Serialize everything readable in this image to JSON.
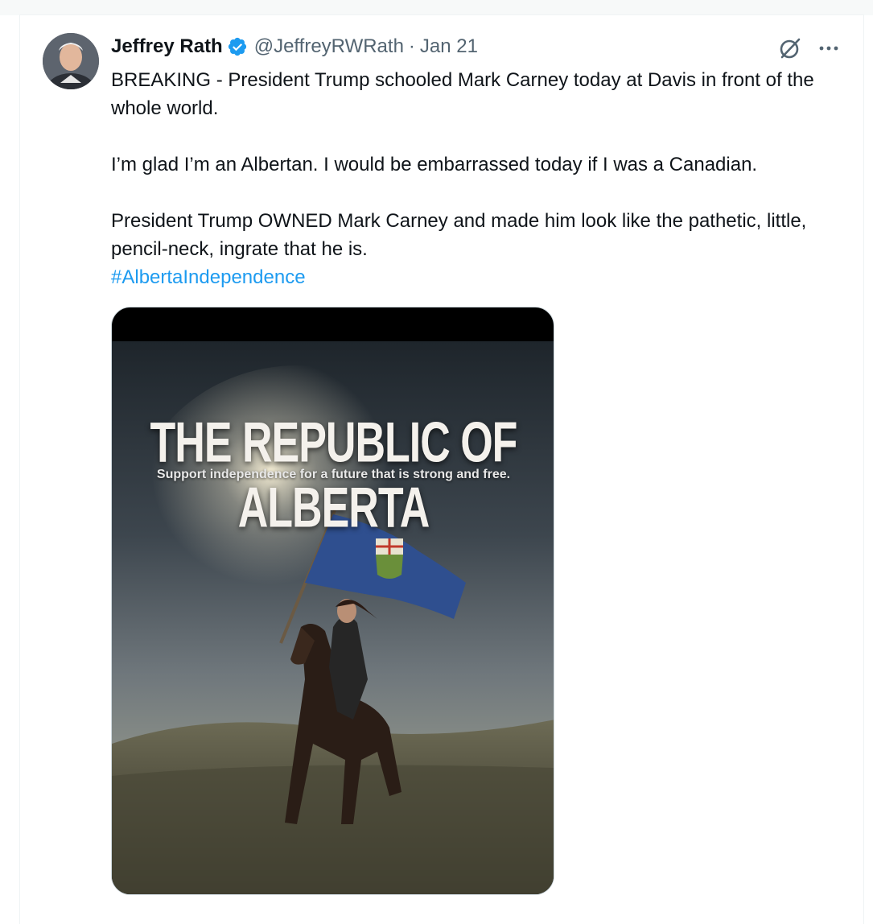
{
  "author": {
    "display_name": "Jeffrey Rath",
    "handle": "@JeffreyRWRath",
    "separator": "·",
    "date": "Jan 21",
    "verified": true
  },
  "icons": {
    "verified": "verified-badge-icon",
    "grok": "grok-icon",
    "more": "more-icon"
  },
  "tweet": {
    "line1": "BREAKING - President Trump schooled Mark Carney today at Davis in front of the whole world.",
    "line2": "I’m glad I’m an Albertan. I would be embarrassed today if I was a Canadian.",
    "line3": "President Trump OWNED Mark Carney and made him look like the pathetic, little, pencil-neck, ingrate that he is.",
    "hashtag": "#AlbertaIndependence"
  },
  "media": {
    "poster_title": "THE REPUBLIC OF ALBERTA",
    "poster_subtitle": "Support independence for a future that is strong and free."
  },
  "colors": {
    "accent": "#1d9bf0",
    "text_primary": "#0f1419",
    "text_secondary": "#536471",
    "flag_blue": "#2f4f8f"
  }
}
